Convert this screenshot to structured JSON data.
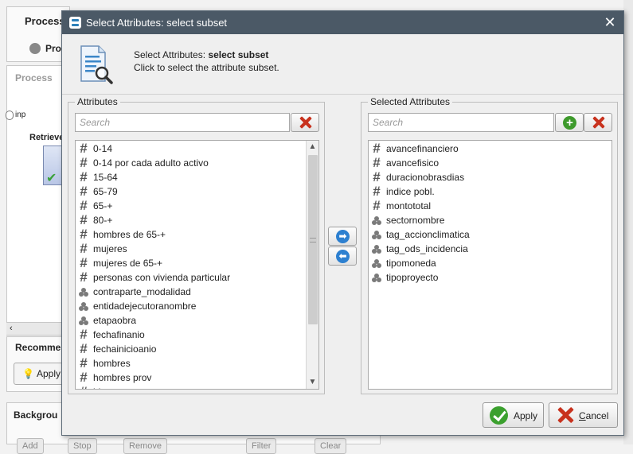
{
  "background": {
    "process_header": "Process",
    "process_tab": "Pro",
    "canvas_label": "Process",
    "port_label": "inp",
    "operator_label": "Retrieve",
    "recommend_header": "Recomme",
    "recommend_apply": "Apply",
    "background_header": "Backgrou",
    "buttons": [
      "Add",
      "Stop",
      "Remove",
      "Filter",
      "Clear"
    ]
  },
  "dialog": {
    "title": "Select Attributes: select subset",
    "header_title_prefix": "Select Attributes: ",
    "header_title_bold": "select subset",
    "header_description": "Click to select the attribute subset.",
    "left": {
      "label": "Attributes",
      "search_placeholder": "Search",
      "items": [
        {
          "icon": "numeric",
          "name": "0-14"
        },
        {
          "icon": "numeric",
          "name": "0-14 por cada adulto activo"
        },
        {
          "icon": "numeric",
          "name": "15-64"
        },
        {
          "icon": "numeric",
          "name": "65-79"
        },
        {
          "icon": "numeric",
          "name": "65-+"
        },
        {
          "icon": "numeric",
          "name": "80-+"
        },
        {
          "icon": "numeric",
          "name": "hombres de 65-+"
        },
        {
          "icon": "numeric",
          "name": "mujeres"
        },
        {
          "icon": "numeric",
          "name": "mujeres de 65-+"
        },
        {
          "icon": "numeric",
          "name": "personas con vivienda particular"
        },
        {
          "icon": "nominal",
          "name": "contraparte_modalidad"
        },
        {
          "icon": "nominal",
          "name": "entidadejecutoranombre"
        },
        {
          "icon": "nominal",
          "name": "etapaobra"
        },
        {
          "icon": "numeric",
          "name": "fechafinanio"
        },
        {
          "icon": "numeric",
          "name": "fechainicioanio"
        },
        {
          "icon": "numeric",
          "name": "hombres"
        },
        {
          "icon": "numeric",
          "name": "hombres prov"
        },
        {
          "icon": "numeric",
          "name": "idproyecto"
        }
      ]
    },
    "right": {
      "label": "Selected Attributes",
      "search_placeholder": "Search",
      "items": [
        {
          "icon": "numeric",
          "name": "avancefinanciero"
        },
        {
          "icon": "numeric",
          "name": "avancefisico"
        },
        {
          "icon": "numeric",
          "name": "duracionobrasdias"
        },
        {
          "icon": "numeric",
          "name": "indice pobl."
        },
        {
          "icon": "numeric",
          "name": "montototal"
        },
        {
          "icon": "nominal",
          "name": "sectornombre"
        },
        {
          "icon": "nominal",
          "name": "tag_accionclimatica"
        },
        {
          "icon": "nominal",
          "name": "tag_ods_incidencia"
        },
        {
          "icon": "nominal",
          "name": "tipomoneda"
        },
        {
          "icon": "nominal",
          "name": "tipoproyecto"
        }
      ]
    },
    "buttons": {
      "apply": "Apply",
      "cancel_first": "C",
      "cancel_rest": "ancel"
    }
  }
}
